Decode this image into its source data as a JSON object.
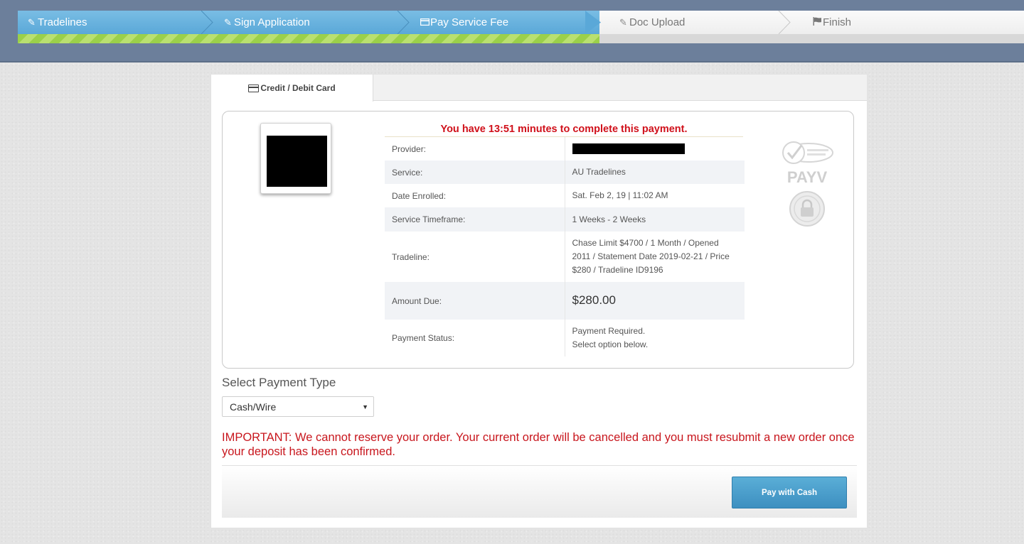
{
  "wizard": {
    "steps": [
      {
        "label": "Tradelines",
        "icon": "pencil-icon",
        "status": "done"
      },
      {
        "label": "Sign Application",
        "icon": "pencil-icon",
        "status": "done"
      },
      {
        "label": "Pay Service Fee",
        "icon": "credit-card-icon",
        "status": "current"
      },
      {
        "label": "Doc Upload",
        "icon": "pencil-icon",
        "status": "todo"
      },
      {
        "label": "Finish",
        "icon": "flag-icon",
        "status": "todo"
      }
    ],
    "progress_fraction": 0.578,
    "colors": {
      "done": "#5aa8d8",
      "progress": "#9bd04a",
      "bar": "#6c7f9b"
    }
  },
  "tabs": [
    {
      "label": "Credit / Debit Card",
      "icon": "credit-card-icon"
    }
  ],
  "summary": {
    "timer_text": "You have 13:51 minutes to complete this payment.",
    "rows": [
      {
        "key": "Provider:",
        "value": ""
      },
      {
        "key": "Service:",
        "value": "AU Tradelines"
      },
      {
        "key": "Date Enrolled:",
        "value": "Sat. Feb 2, 19 | 11:02 AM"
      },
      {
        "key": "Service Timeframe:",
        "value": "1 Weeks - 2 Weeks"
      },
      {
        "key": "Tradeline:",
        "value": "Chase Limit $4700 / 1 Month / Opened 2011 / Statement Date 2019-02-21 / Price $280 / Tradeline ID9196"
      },
      {
        "key": "Amount Due:",
        "value": "$280.00"
      },
      {
        "key": "Payment Status:",
        "value": "Payment Required.",
        "value2": "Select option below."
      }
    ],
    "seals": [
      "verified-seal-icon",
      "payv-logo",
      "security-lock-seal-icon"
    ],
    "seal_text": "PAYV"
  },
  "payment": {
    "label": "Select Payment Type",
    "selected": "Cash/Wire",
    "important": "IMPORTANT: We cannot reserve your order. Your current order will be cancelled and you must resubmit a new order once your deposit has been confirmed.",
    "button_label": "Pay with Cash"
  }
}
